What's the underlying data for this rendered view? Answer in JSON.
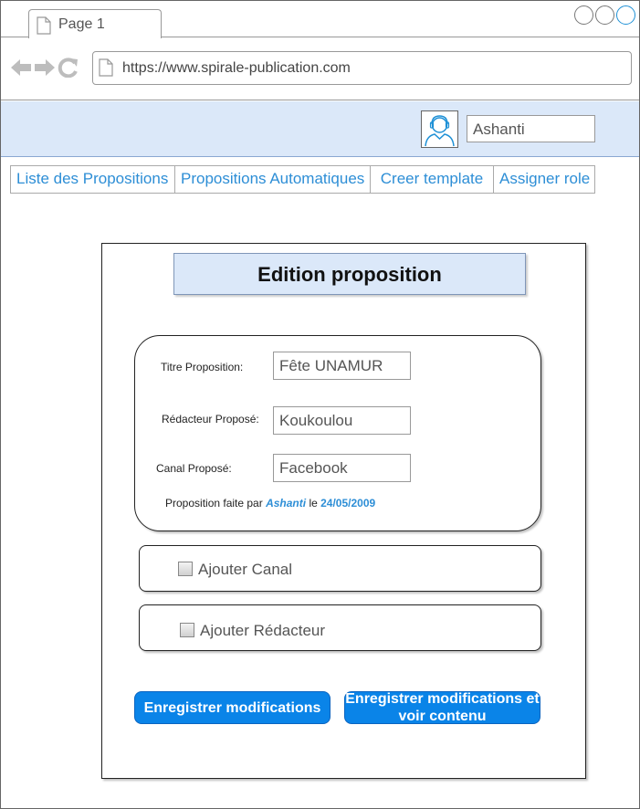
{
  "browser": {
    "tab_label": "Page 1",
    "url": "https://www.spirale-publication.com"
  },
  "header": {
    "username": "Ashanti"
  },
  "menu": {
    "items": [
      {
        "label": "Liste des Propositions"
      },
      {
        "label": "Propositions Automatiques"
      },
      {
        "label": "Creer template"
      },
      {
        "label": "Assigner role"
      }
    ]
  },
  "panel": {
    "title": "Edition proposition",
    "form": {
      "title_label": "Titre Proposition:",
      "title_value": "Fête UNAMUR",
      "editor_label": "Rédacteur Proposé:",
      "editor_value": "Koukoulou",
      "channel_label": "Canal Proposé:",
      "channel_value": "Facebook",
      "note_prefix": "Proposition faite par",
      "note_author": "Ashanti",
      "note_middle": "le",
      "note_date": "24/05/2009"
    },
    "options": {
      "add_channel": "Ajouter Canal",
      "add_editor": "Ajouter Rédacteur"
    },
    "buttons": {
      "save": "Enregistrer modifications",
      "save_and_view": "Enregistrer modifications et voir contenu"
    }
  },
  "colors": {
    "link": "#2d8ed6",
    "header_band": "#dbe8f9",
    "button": "#0a84e8"
  },
  "icons": [
    "page-icon",
    "back-arrow-icon",
    "forward-arrow-icon",
    "reload-icon",
    "user-avatar-icon",
    "checkbox-icon"
  ]
}
